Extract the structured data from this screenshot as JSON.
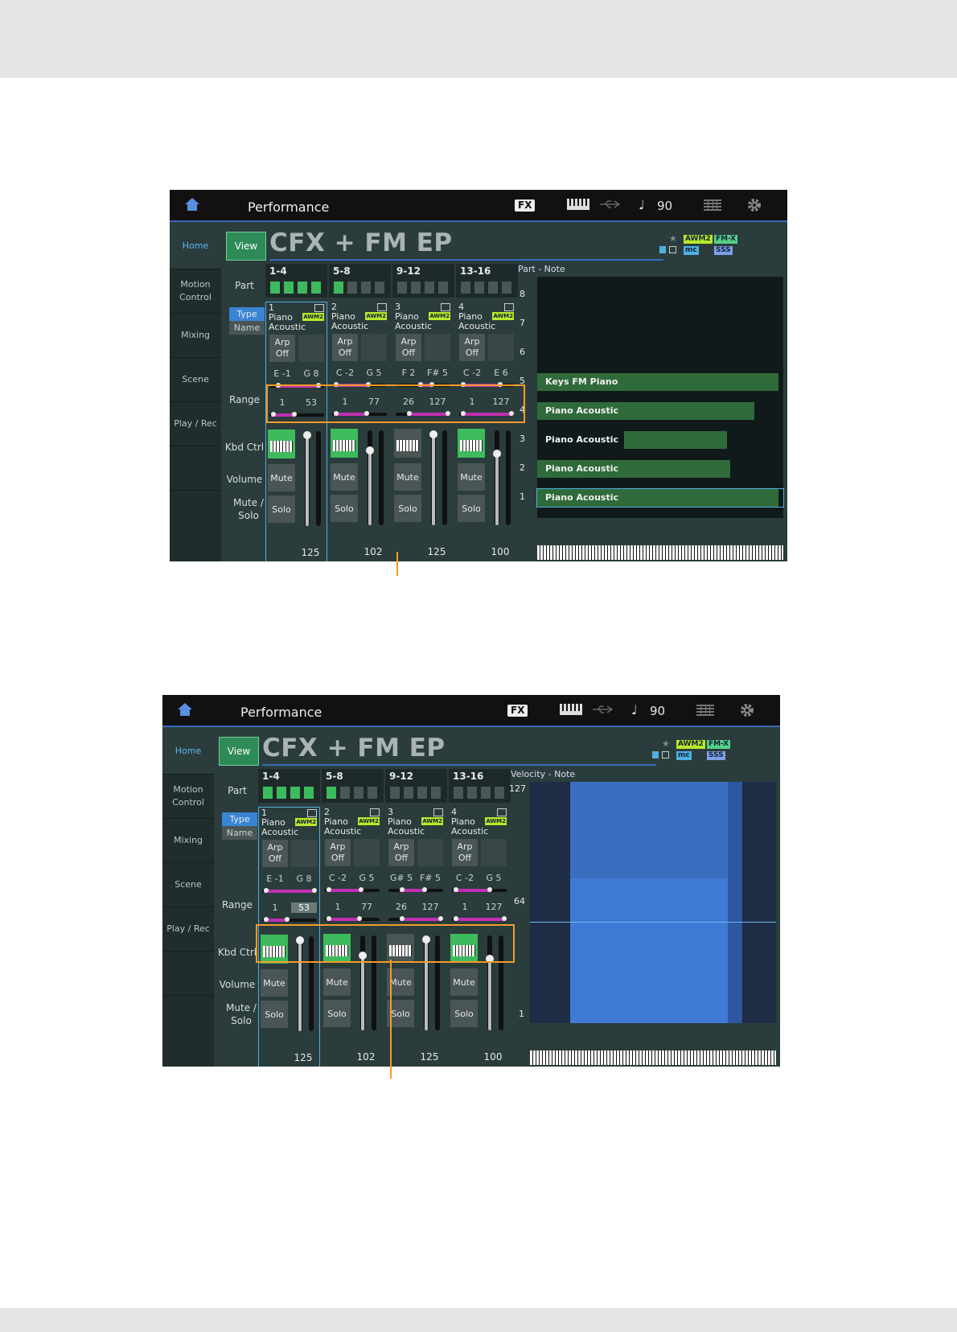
{
  "screens": [
    {
      "header": {
        "title": "Performance",
        "fx": "FX",
        "note": "♩",
        "tempo": "90"
      },
      "sidebar": {
        "items": [
          "Home",
          "Motion Control",
          "Mixing",
          "Scene",
          "Play / Rec"
        ]
      },
      "main": {
        "view_label": "View",
        "performance_name": "CFX + FM EP",
        "badges": {
          "awm": "AWM2",
          "fmx": "FM-X",
          "mc": "mc",
          "sss": "SSS"
        },
        "row_labels": {
          "part": "Part",
          "type": "Type",
          "name": "Name",
          "range": "Range",
          "kbd_ctrl": "Kbd Ctrl",
          "volume": "Volume",
          "mute_solo": "Mute / Solo"
        },
        "groups": [
          {
            "label": "1-4",
            "active": [
              true,
              true,
              true,
              true
            ]
          },
          {
            "label": "5-8",
            "active": [
              true,
              false,
              false,
              false
            ]
          },
          {
            "label": "9-12",
            "active": [
              false,
              false,
              false,
              false
            ]
          },
          {
            "label": "13-16",
            "active": [
              false,
              false,
              false,
              false
            ]
          }
        ],
        "parts": [
          {
            "num": "1",
            "line1": "Piano",
            "line2": "Acoustic",
            "engine": "AWM2",
            "arp_l1": "Arp",
            "arp_l2": "Off",
            "note_lo": "E -1",
            "note_hi": "G 8",
            "vel_lo": "1",
            "vel_hi": "53",
            "mute": "Mute",
            "solo": "Solo",
            "volume": "125"
          },
          {
            "num": "2",
            "line1": "Piano",
            "line2": "Acoustic",
            "engine": "AWM2",
            "arp_l1": "Arp",
            "arp_l2": "Off",
            "note_lo": "C -2",
            "note_hi": "G 5",
            "vel_lo": "1",
            "vel_hi": "77",
            "mute": "Mute",
            "solo": "Solo",
            "volume": "102"
          },
          {
            "num": "3",
            "line1": "Piano",
            "line2": "Acoustic",
            "engine": "AWM2",
            "arp_l1": "Arp",
            "arp_l2": "Off",
            "note_lo": "F 2",
            "note_hi": "F# 5",
            "vel_lo": "26",
            "vel_hi": "127",
            "mute": "Mute",
            "solo": "Solo",
            "volume": "125"
          },
          {
            "num": "4",
            "line1": "Piano",
            "line2": "Acoustic",
            "engine": "AWM2",
            "arp_l1": "Arp",
            "arp_l2": "Off",
            "note_lo": "C -2",
            "note_hi": "E 6",
            "vel_lo": "1",
            "vel_hi": "127",
            "mute": "Mute",
            "solo": "Solo",
            "volume": "100"
          }
        ],
        "graph": {
          "title": "Part - Note",
          "rows": [
            {
              "num": "8",
              "name": ""
            },
            {
              "num": "7",
              "name": ""
            },
            {
              "num": "6",
              "name": ""
            },
            {
              "num": "5",
              "name": "Keys FM Piano"
            },
            {
              "num": "4",
              "name": "Piano Acoustic"
            },
            {
              "num": "3",
              "name": "Piano Acoustic"
            },
            {
              "num": "2",
              "name": "Piano Acoustic"
            },
            {
              "num": "1",
              "name": "Piano Acoustic"
            }
          ]
        }
      }
    },
    {
      "header": {
        "title": "Performance",
        "fx": "FX",
        "note": "♩",
        "tempo": "90"
      },
      "sidebar": {
        "items": [
          "Home",
          "Motion Control",
          "Mixing",
          "Scene",
          "Play / Rec"
        ]
      },
      "main": {
        "view_label": "View",
        "performance_name": "CFX + FM EP",
        "badges": {
          "awm": "AWM2",
          "fmx": "FM-X",
          "mc": "mc",
          "sss": "SSS"
        },
        "row_labels": {
          "part": "Part",
          "type": "Type",
          "name": "Name",
          "range": "Range",
          "kbd_ctrl": "Kbd Ctrl",
          "volume": "Volume",
          "mute_solo": "Mute / Solo"
        },
        "groups": [
          {
            "label": "1-4",
            "active": [
              true,
              true,
              true,
              true
            ]
          },
          {
            "label": "5-8",
            "active": [
              true,
              false,
              false,
              false
            ]
          },
          {
            "label": "9-12",
            "active": [
              false,
              false,
              false,
              false
            ]
          },
          {
            "label": "13-16",
            "active": [
              false,
              false,
              false,
              false
            ]
          }
        ],
        "parts": [
          {
            "num": "1",
            "line1": "Piano",
            "line2": "Acoustic",
            "engine": "AWM2",
            "arp_l1": "Arp",
            "arp_l2": "Off",
            "note_lo": "E -1",
            "note_hi": "G 8",
            "vel_lo": "1",
            "vel_hi": "53",
            "mute": "Mute",
            "solo": "Solo",
            "volume": "125"
          },
          {
            "num": "2",
            "line1": "Piano",
            "line2": "Acoustic",
            "engine": "AWM2",
            "arp_l1": "Arp",
            "arp_l2": "Off",
            "note_lo": "C -2",
            "note_hi": "G 5",
            "vel_lo": "1",
            "vel_hi": "77",
            "mute": "Mute",
            "solo": "Solo",
            "volume": "102"
          },
          {
            "num": "3",
            "line1": "Piano",
            "line2": "Acoustic",
            "engine": "AWM2",
            "arp_l1": "Arp",
            "arp_l2": "Off",
            "note_lo": "G# 5",
            "note_hi": "F# 5",
            "vel_lo": "26",
            "vel_hi": "127",
            "mute": "Mute",
            "solo": "Solo",
            "volume": "125"
          },
          {
            "num": "4",
            "line1": "Piano",
            "line2": "Acoustic",
            "engine": "AWM2",
            "arp_l1": "Arp",
            "arp_l2": "Off",
            "note_lo": "C -2",
            "note_hi": "G 5",
            "vel_lo": "1",
            "vel_hi": "127",
            "mute": "Mute",
            "solo": "Solo",
            "volume": "100"
          }
        ],
        "graph": {
          "title": "Velocity - Note",
          "y_top": "127",
          "y_mid": "64",
          "y_bot": "1"
        }
      }
    }
  ]
}
